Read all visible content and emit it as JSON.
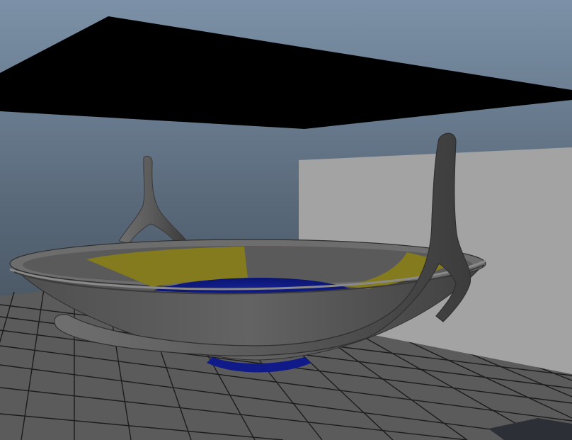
{
  "viewport": {
    "camera": "persp",
    "background_top": "#7d93a9",
    "background_bottom": "#3a424b",
    "grid_color": "#1e1e1e",
    "floor_color": "#5c5c5c",
    "panel_color": "#a4a4a4",
    "ceiling_color": "#000000"
  },
  "model": {
    "bowl_color": "#5b5b5b",
    "rim_color": "#666666",
    "accent_color": "#847a1f",
    "liquid_color": "#0d1a8f",
    "handle_color": "#5a5a5a"
  }
}
